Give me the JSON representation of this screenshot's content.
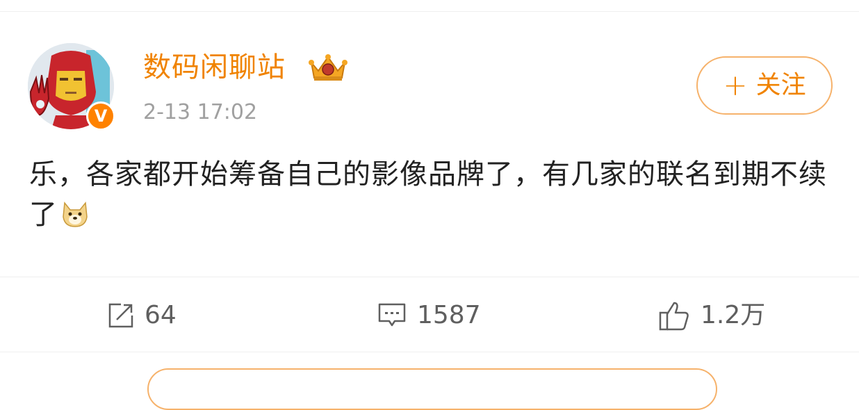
{
  "post": {
    "author": {
      "name": "数码闲聊站",
      "verified_badge": "V",
      "timestamp": "2-13 17:02"
    },
    "follow_button": {
      "plus": "+",
      "label": "关注"
    },
    "content": {
      "text": "乐，各家都开始筹备自己的影像品牌了，有几家的联名到期不续了",
      "emoji": "doge-icon"
    },
    "actions": {
      "reposts": "64",
      "comments": "1587",
      "likes": "1.2万"
    }
  },
  "colors": {
    "accent": "#f08300",
    "follow_border": "#f6b26b",
    "timestamp": "#a0a0a0",
    "text": "#222222",
    "action": "#5f5f5f"
  }
}
